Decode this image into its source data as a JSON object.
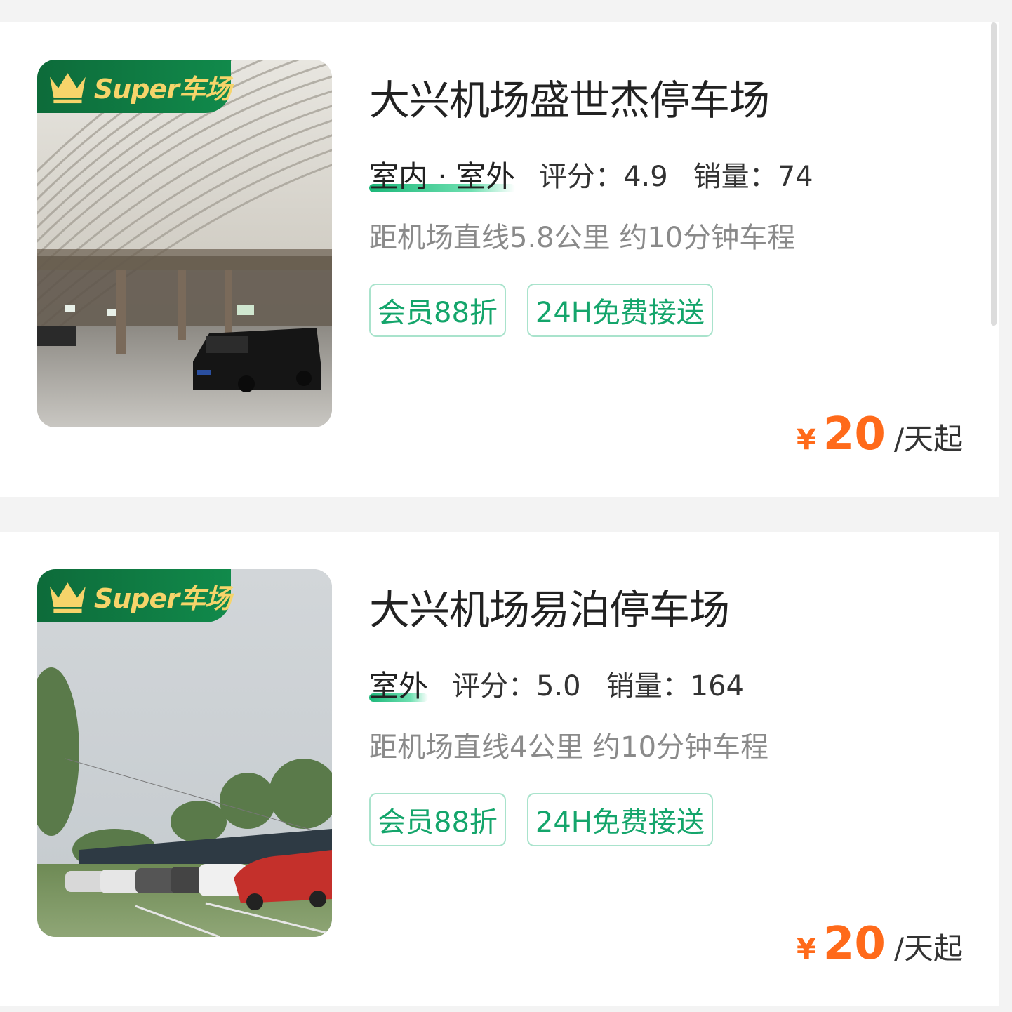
{
  "listings": [
    {
      "badge": "Super车场",
      "title": "大兴机场盛世杰停车场",
      "type_label": "室内 · 室外",
      "rating_label": "评分：",
      "rating": "4.9",
      "sales_label": "销量：",
      "sales": "74",
      "distance": "距机场直线5.8公里 约10分钟车程",
      "tags": [
        "会员88折",
        "24H免费接送"
      ],
      "price_symbol": "¥",
      "price": "20",
      "price_unit": "/天起"
    },
    {
      "badge": "Super车场",
      "title": "大兴机场易泊停车场",
      "type_label": "室外",
      "rating_label": "评分：",
      "rating": "5.0",
      "sales_label": "销量：",
      "sales": "164",
      "distance": "距机场直线4公里 约10分钟车程",
      "tags": [
        "会员88折",
        "24H免费接送"
      ],
      "price_symbol": "¥",
      "price": "20",
      "price_unit": "/天起"
    }
  ],
  "colors": {
    "accent_green": "#14a56b",
    "badge_green": "#0d6b3a",
    "badge_gold": "#f6d46a",
    "price_orange": "#ff6a1a"
  },
  "icons": {
    "badge_icon": "crown-icon"
  }
}
